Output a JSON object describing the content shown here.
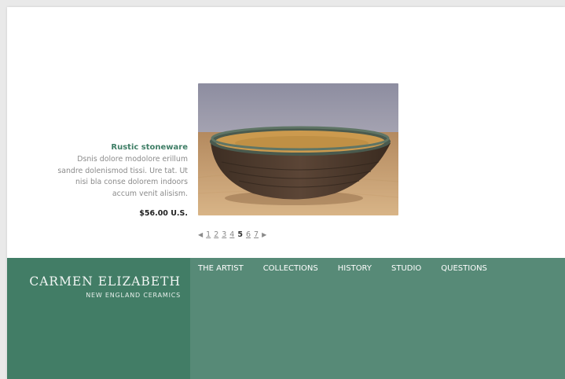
{
  "product": {
    "title": "Rustic stoneware",
    "description": "Dsnis dolore modolore erillum sandre dolenismod tissi. Ure tat. Ut nisi bla conse dolorem indoors accum venit alisism.",
    "price": "$56.00 U.S."
  },
  "pager": {
    "prev_icon": "triangle-left-icon",
    "next_icon": "triangle-right-icon",
    "pages": [
      "1",
      "2",
      "3",
      "4",
      "5",
      "6",
      "7"
    ],
    "current": "5"
  },
  "brand": {
    "name": "CARMEN ELIZABETH",
    "subtitle": "NEW ENGLAND CERAMICS"
  },
  "nav": {
    "items": [
      "THE ARTIST",
      "COLLECTIONS",
      "HISTORY",
      "STUDIO",
      "QUESTIONS"
    ]
  },
  "colors": {
    "accent": "#3f7e66",
    "footer": "#578a77",
    "brand_panel": "#427d66",
    "page_bg": "#ffffff"
  }
}
